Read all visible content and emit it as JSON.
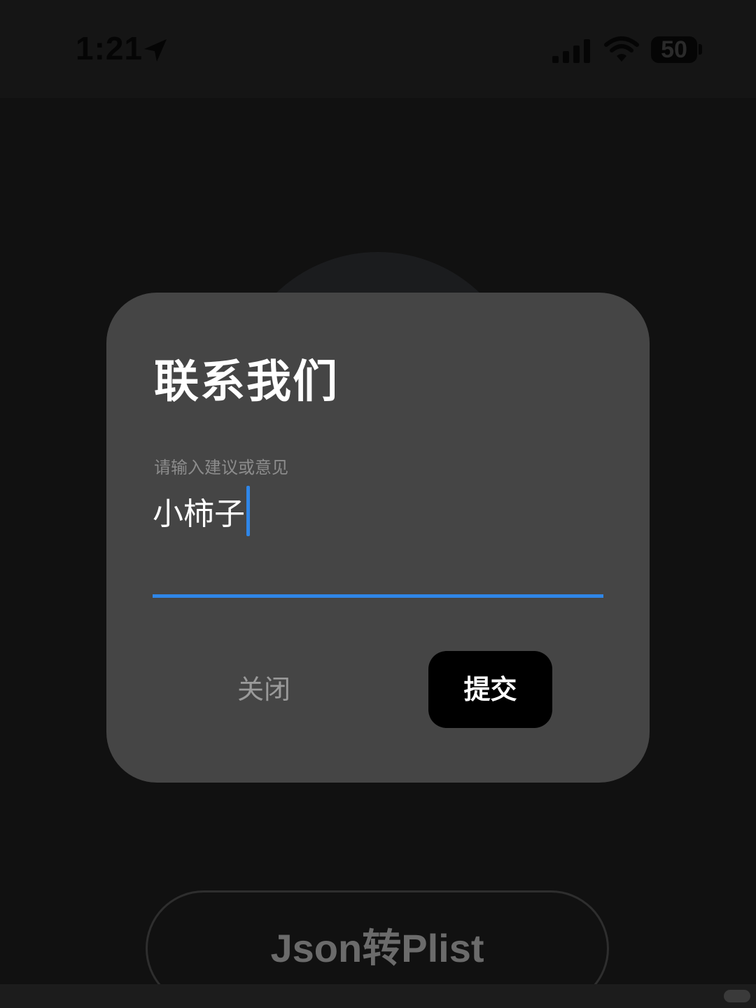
{
  "status_bar": {
    "time": "1:21",
    "battery_level": "50",
    "icons": [
      "location-arrow-icon",
      "cellular-signal-icon",
      "wifi-icon",
      "battery-icon"
    ]
  },
  "background": {
    "primary_button_label": "Json转Plist"
  },
  "dialog": {
    "title": "联系我们",
    "input": {
      "placeholder": "请输入建议或意见",
      "value": "小柿子"
    },
    "close_label": "关闭",
    "submit_label": "提交"
  },
  "colors": {
    "accent": "#2f86e8",
    "dialog_bg": "#454545",
    "page_bg": "#111111",
    "submit_bg": "#000000"
  }
}
